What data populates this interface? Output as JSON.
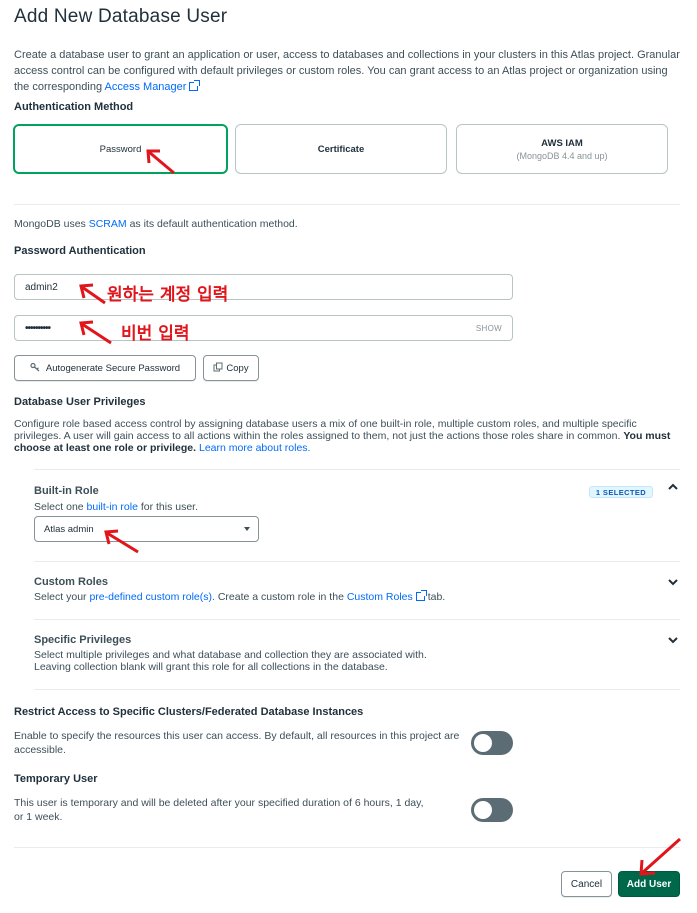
{
  "page": {
    "title": "Add New Database User",
    "intro_text": "Create a database user to grant an application or user, access to databases and collections in your clusters in this Atlas project. Granular access control can be configured with default privileges or custom roles. You can grant access to an Atlas project or organization using the corresponding",
    "intro_link": "Access Manager"
  },
  "auth": {
    "label": "Authentication Method",
    "options": [
      {
        "label": "Password",
        "sub": "",
        "selected": true
      },
      {
        "label": "Certificate",
        "sub": "",
        "selected": false
      },
      {
        "label": "AWS IAM",
        "sub": "(MongoDB 4.4 and up)",
        "selected": false
      }
    ],
    "scram_prefix": "MongoDB uses",
    "scram_link": "SCRAM",
    "scram_suffix": "as its default authentication method."
  },
  "password_auth": {
    "label": "Password Authentication",
    "username_value": "admin2",
    "password_value": "••••••••••",
    "show_label": "SHOW",
    "autogen_label": "Autogenerate Secure Password",
    "copy_label": "Copy"
  },
  "privileges": {
    "label": "Database User Privileges",
    "desc_text": "Configure role based access control by assigning database users a mix of one built-in role, multiple custom roles, and multiple specific privileges. A user will gain access to all actions within the roles assigned to them, not just the actions those roles share in common.",
    "desc_bold": "You must choose at least one role or privilege.",
    "desc_link": "Learn more about roles.",
    "builtin": {
      "title": "Built-in Role",
      "badge": "1 SELECTED",
      "desc_prefix": "Select one",
      "desc_link": "built-in role",
      "desc_suffix": "for this user.",
      "selected_value": "Atlas admin"
    },
    "custom": {
      "title": "Custom Roles",
      "desc_prefix": "Select your",
      "desc_link": "pre-defined custom role(s).",
      "desc_mid": "Create a custom role in the",
      "desc_link2": "Custom Roles",
      "desc_suffix": "tab."
    },
    "specific": {
      "title": "Specific Privileges",
      "line1": "Select multiple privileges and what database and collection they are associated with.",
      "line2": "Leaving collection blank will grant this role for all collections in the database."
    }
  },
  "restrict": {
    "title": "Restrict Access to Specific Clusters/Federated Database Instances",
    "desc": "Enable to specify the resources this user can access. By default, all resources in this project are accessible.",
    "enabled": false
  },
  "temporary": {
    "title": "Temporary User",
    "desc": "This user is temporary and will be deleted after your specified duration of 6 hours, 1 day, or 1 week.",
    "enabled": false
  },
  "footer": {
    "cancel_label": "Cancel",
    "add_label": "Add User"
  },
  "annotations": {
    "username_note": "원하는 계정 입력",
    "password_note": "비번 입력"
  },
  "colors": {
    "accent_green": "#00a35c",
    "primary_button": "#00684a",
    "link": "#016bf8",
    "annotation_red": "#e0161c"
  }
}
